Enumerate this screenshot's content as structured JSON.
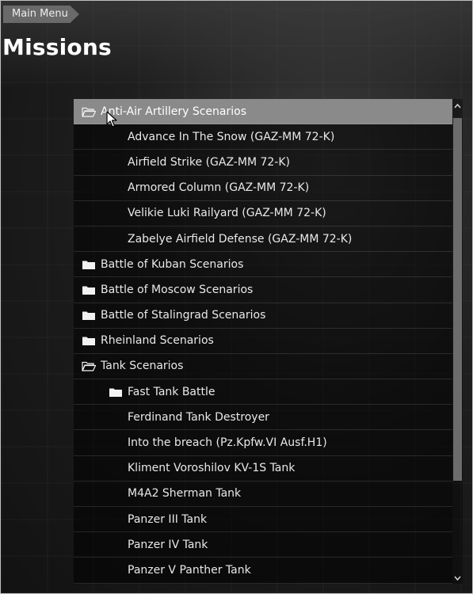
{
  "header": {
    "back_label": "Main Menu",
    "title": "Missions"
  },
  "tree": {
    "items": [
      {
        "label": "Anti-Air Artillery Scenarios",
        "kind": "folder-open",
        "level": 0,
        "selected": true
      },
      {
        "label": "Advance In The Snow (GAZ-MM 72-K)",
        "kind": "mission",
        "level": 1
      },
      {
        "label": "Airfield Strike (GAZ-MM 72-K)",
        "kind": "mission",
        "level": 1
      },
      {
        "label": "Armored Column (GAZ-MM 72-K)",
        "kind": "mission",
        "level": 1
      },
      {
        "label": "Velikie Luki Railyard (GAZ-MM 72-K)",
        "kind": "mission",
        "level": 1
      },
      {
        "label": "Zabelye Airfield Defense (GAZ-MM 72-K)",
        "kind": "mission",
        "level": 1
      },
      {
        "label": "Battle of Kuban Scenarios",
        "kind": "folder-closed",
        "level": 0
      },
      {
        "label": "Battle of Moscow Scenarios",
        "kind": "folder-closed",
        "level": 0
      },
      {
        "label": "Battle of Stalingrad Scenarios",
        "kind": "folder-closed",
        "level": 0
      },
      {
        "label": "Rheinland Scenarios",
        "kind": "folder-closed",
        "level": 0
      },
      {
        "label": "Tank Scenarios",
        "kind": "folder-open",
        "level": 0
      },
      {
        "label": "Fast Tank Battle",
        "kind": "folder-closed",
        "level": 1
      },
      {
        "label": "Ferdinand Tank Destroyer",
        "kind": "mission",
        "level": 1
      },
      {
        "label": "Into the breach (Pz.Kpfw.VI Ausf.H1)",
        "kind": "mission",
        "level": 1
      },
      {
        "label": "Kliment Voroshilov KV-1S Tank",
        "kind": "mission",
        "level": 1
      },
      {
        "label": "M4A2 Sherman Tank",
        "kind": "mission",
        "level": 1
      },
      {
        "label": "Panzer III Tank",
        "kind": "mission",
        "level": 1
      },
      {
        "label": "Panzer IV Tank",
        "kind": "mission",
        "level": 1
      },
      {
        "label": "Panzer V Panther Tank",
        "kind": "mission",
        "level": 1
      }
    ]
  },
  "colors": {
    "selected_row": "#8a8a8a",
    "row_background": "#000000",
    "text": "#e9e9e9",
    "back_tab": "#6a6a6a"
  },
  "icons": {
    "folder_open": "folder-open-icon",
    "folder_closed": "folder-icon",
    "scroll_up": "chevron-up-icon",
    "scroll_down": "chevron-down-icon",
    "pointer": "mouse-pointer-icon"
  }
}
